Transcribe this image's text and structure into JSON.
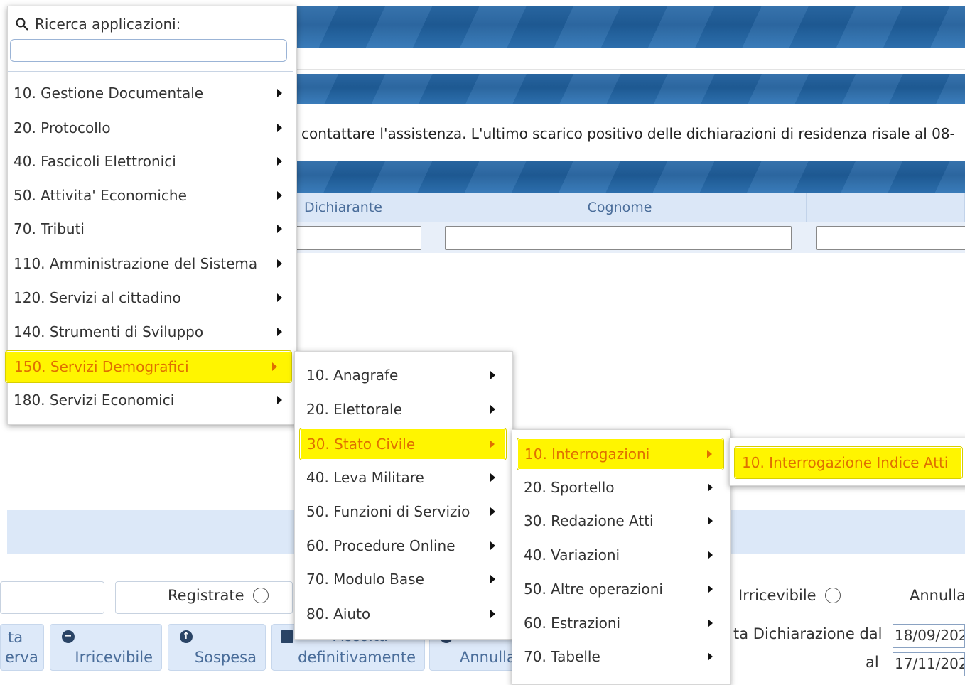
{
  "notice": "contattare l'assistenza. L'ultimo scarico positivo delle dichiarazioni di residenza risale al 08-",
  "table": {
    "columns": [
      "Dichiarante",
      "Cognome",
      ""
    ]
  },
  "filters": {
    "radios": [
      "Registrate",
      "Irricevibile",
      "Annulla"
    ]
  },
  "buttons": [
    {
      "label": "erva",
      "top": "ta",
      "icon": ""
    },
    {
      "label": "Irricevibile",
      "icon": "minus-circle"
    },
    {
      "label": "Sospesa",
      "icon": "up-arrow-circle"
    },
    {
      "label": "definitivamente",
      "top": "Accolta",
      "icon": "save"
    },
    {
      "label": "Annulla",
      "icon": "undo"
    }
  ],
  "dates": {
    "from_label": "ta Dichiarazione dal",
    "from_value": "18/09/202",
    "to_label": "al",
    "to_value": "17/11/202"
  },
  "app_menu": {
    "search_label": "Ricerca applicazioni:",
    "search_value": "",
    "items": [
      "10. Gestione Documentale",
      "20. Protocollo",
      "40. Fascicoli Elettronici",
      "50. Attivita' Economiche",
      "70. Tributi",
      "110. Amministrazione del Sistema",
      "120. Servizi al cittadino",
      "140. Strumenti di Sviluppo",
      "150. Servizi Demografici",
      "180. Servizi Economici"
    ],
    "selected_index": 8
  },
  "submenu_demografici": {
    "items": [
      "10. Anagrafe",
      "20. Elettorale",
      "30. Stato Civile",
      "40. Leva Militare",
      "50. Funzioni di Servizio",
      "60. Procedure Online",
      "70. Modulo Base",
      "80. Aiuto"
    ],
    "selected_index": 2
  },
  "submenu_stato_civile": {
    "items": [
      "10. Interrogazioni",
      "20. Sportello",
      "30. Redazione Atti",
      "40. Variazioni",
      "50. Altre operazioni",
      "60. Estrazioni",
      "70. Tabelle"
    ],
    "selected_index": 0
  },
  "submenu_interrogazioni": {
    "items": [
      "10. Interrogazione Indice Atti"
    ],
    "selected_index": 0
  },
  "colors": {
    "highlight": "#fff500",
    "highlight_text": "#e07000",
    "band": "#1f5d99"
  }
}
